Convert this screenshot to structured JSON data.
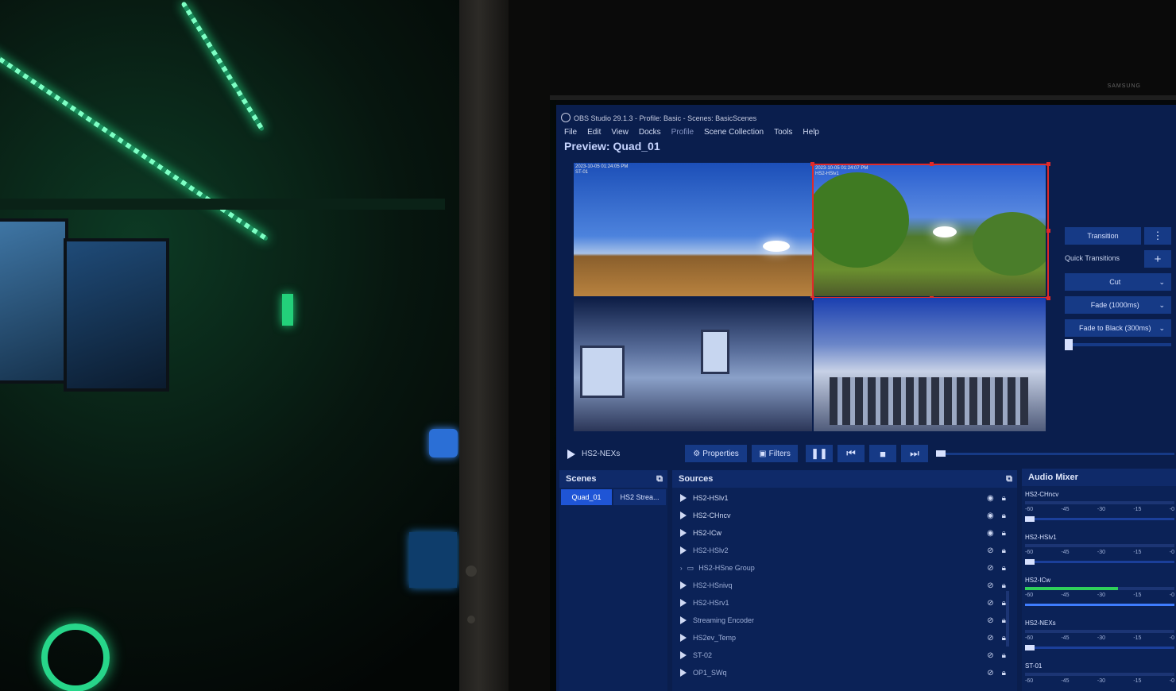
{
  "obs": {
    "window_title": "OBS Studio 29.1.3 - Profile: Basic - Scenes: BasicScenes",
    "menu": [
      "File",
      "Edit",
      "View",
      "Docks",
      "Profile",
      "Scene Collection",
      "Tools",
      "Help"
    ],
    "preview_title": "Preview: Quad_01",
    "preview": {
      "cam1": {
        "stamp": "2023-10-05 01:24:05 PM\nST-01"
      },
      "cam2": {
        "stamp": "2023-10-05 01:24:07 PM\nHS2-HSlv1"
      }
    },
    "transitions": {
      "transition_button": "Transition",
      "quick_label": "Quick Transitions",
      "options": [
        "Cut",
        "Fade (1000ms)",
        "Fade to Black (300ms)"
      ]
    },
    "controls": {
      "current_source": "HS2-NEXs",
      "properties": "Properties",
      "filters": "Filters"
    },
    "scenes": {
      "title": "Scenes",
      "items": [
        "Quad_01",
        "HS2 Strea..."
      ],
      "active": "Quad_01"
    },
    "sources": {
      "title": "Sources",
      "items": [
        {
          "label": "HS2-HSlv1",
          "visible": true
        },
        {
          "label": "HS2-CHncv",
          "visible": true
        },
        {
          "label": "HS2-ICw",
          "visible": true
        },
        {
          "label": "HS2-HSlv2",
          "visible": false
        },
        {
          "label": "HS2-HSne Group",
          "visible": false,
          "group": true
        },
        {
          "label": "HS2-HSnivq",
          "visible": false
        },
        {
          "label": "HS2-HSrv1",
          "visible": false
        },
        {
          "label": "Streaming Encoder",
          "visible": false
        },
        {
          "label": "HS2ev_Temp",
          "visible": false
        },
        {
          "label": "ST-02",
          "visible": false
        },
        {
          "label": "OP1_SWq",
          "visible": false
        }
      ]
    },
    "mixer": {
      "title": "Audio Mixer",
      "ticks": [
        "-60",
        "-45",
        "-30",
        "-15",
        "-0"
      ],
      "channels": [
        {
          "name": "HS2-CHncv",
          "level": 0.0
        },
        {
          "name": "HS2-HSlv1",
          "level": 0.0
        },
        {
          "name": "HS2-ICw",
          "level": 0.62
        },
        {
          "name": "HS2-NEXs",
          "level": 0.0
        },
        {
          "name": "ST-01",
          "level": 0.0
        }
      ]
    },
    "icons": {
      "eye": "eye-icon",
      "lock": "lock-icon",
      "hidden": "eye-off-icon",
      "play": "play-icon",
      "pause": "pause-icon",
      "stop": "stop-icon",
      "prev": "skip-back-icon",
      "next": "skip-forward-icon"
    },
    "colors": {
      "panel": "#0a1e4d",
      "button": "#163a86",
      "selection": "#e02a2a",
      "meter": "#2fd05a"
    }
  },
  "monitor_brand": "SAMSUNG"
}
